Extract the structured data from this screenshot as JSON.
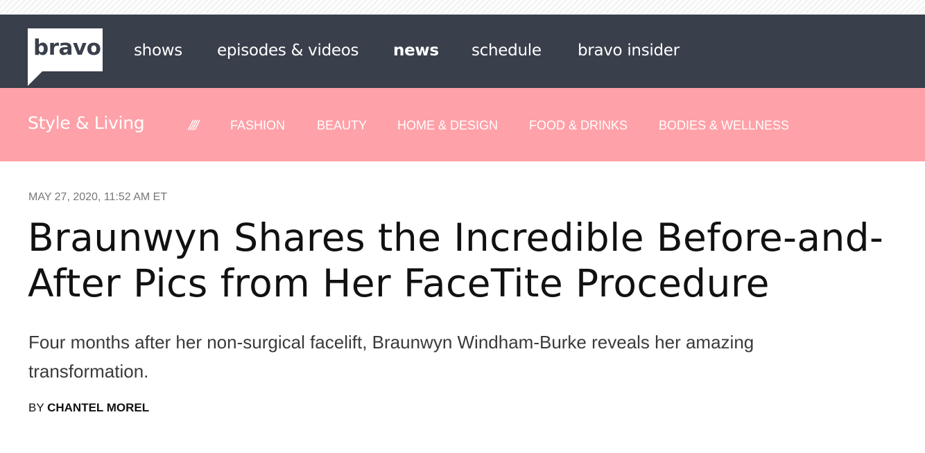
{
  "logo": {
    "text": "bravo"
  },
  "main_nav": {
    "items": [
      {
        "label": "shows",
        "active": false
      },
      {
        "label": "episodes & videos",
        "active": false
      },
      {
        "label": "news",
        "active": true
      },
      {
        "label": "schedule",
        "active": false
      },
      {
        "label": "bravo insider",
        "active": false
      }
    ]
  },
  "sub_nav": {
    "section_title": "Style & Living",
    "divider": "////",
    "items": [
      {
        "label": "FASHION"
      },
      {
        "label": "BEAUTY"
      },
      {
        "label": "HOME & DESIGN"
      },
      {
        "label": "FOOD & DRINKS"
      },
      {
        "label": "BODIES & WELLNESS"
      }
    ]
  },
  "article": {
    "date": "MAY 27, 2020, 11:52 AM ET",
    "headline": "Braunwyn Shares the Incredible Before-and-After Pics from Her FaceTite Procedure",
    "dek": "Four months after her non-surgical facelift, Braunwyn Windham-Burke reveals her amazing transformation.",
    "byline_prefix": "BY ",
    "author": "CHANTEL MOREL"
  },
  "colors": {
    "main_nav_bg": "#393f4b",
    "sub_nav_bg": "#ffa1a8",
    "text_dark": "#111111",
    "date_gray": "#777777"
  }
}
